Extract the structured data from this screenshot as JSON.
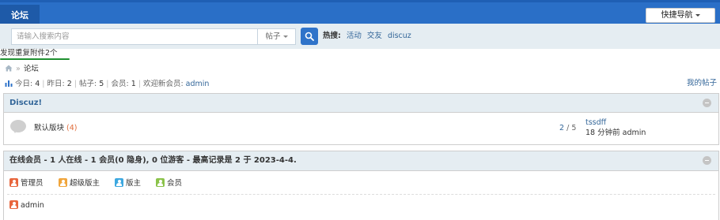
{
  "header": {
    "brand": "论坛",
    "quick_nav": "快捷导航"
  },
  "search": {
    "placeholder": "请输入搜索内容",
    "type": "帖子",
    "hot_label": "热搜:",
    "hot_words": [
      "活动",
      "交友",
      "discuz"
    ]
  },
  "notice": "发现重复附件2个",
  "breadcrumb": {
    "current": "论坛"
  },
  "stats": {
    "today_label": "今日:",
    "today": "4",
    "yesterday_label": "昨日:",
    "yesterday": "2",
    "posts_label": "帖子:",
    "posts": "5",
    "members_label": "会员:",
    "members": "1",
    "welcome_label": "欢迎新会员:",
    "newest_member": "admin",
    "my_posts": "我的帖子"
  },
  "category": {
    "title": "Discuz!",
    "forum": {
      "name": "默认版块",
      "count": "(4)",
      "threads": "2",
      "sep": "/",
      "replies": "5",
      "last_title": "tssdff",
      "last_info": "18 分钟前 admin"
    }
  },
  "online": {
    "title": "在线会员 - 1 人在线 - 1 会员(0 隐身), 0 位游客 - 最高记录是 2 于 2023-4-4.",
    "legend": [
      "管理员",
      "超级版主",
      "版主",
      "会员"
    ],
    "users": [
      "admin"
    ]
  }
}
